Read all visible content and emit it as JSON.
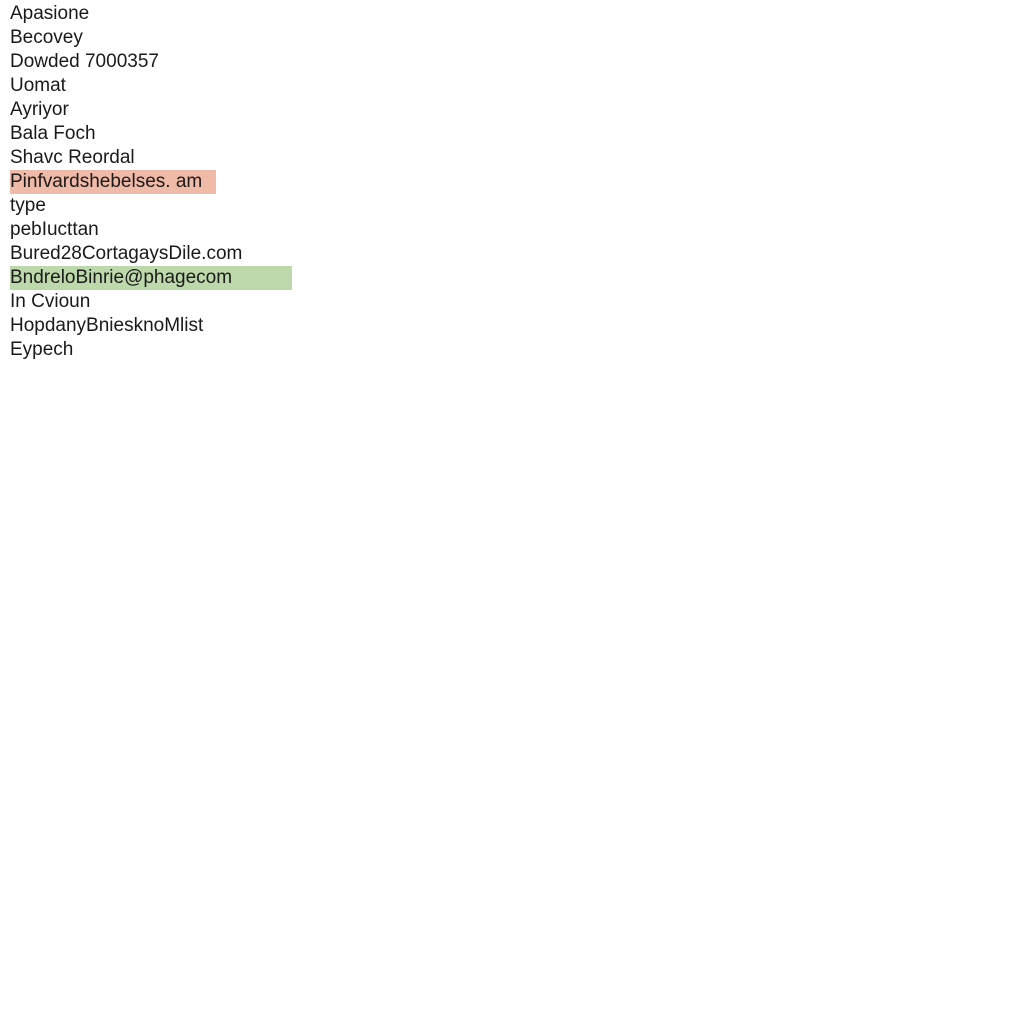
{
  "list": {
    "items": [
      {
        "text": "Apasione",
        "highlight": null
      },
      {
        "text": "Becovey",
        "highlight": null
      },
      {
        "text": "Dowded 7000357",
        "highlight": null
      },
      {
        "text": "Uomat",
        "highlight": null
      },
      {
        "text": "Ayriyor",
        "highlight": null
      },
      {
        "text": "Bala Foch",
        "highlight": null
      },
      {
        "text": "Shavc Reordal",
        "highlight": null
      },
      {
        "text": "Pinfvardshebelses. am",
        "highlight": "red"
      },
      {
        "text": "type",
        "highlight": null
      },
      {
        "text": "pebIucttan",
        "highlight": null
      },
      {
        "text": "Bured28CortagaysDile.com",
        "highlight": null
      },
      {
        "text": "BndreloBinrie@phagecom",
        "highlight": "green"
      },
      {
        "text": "In Cvioun",
        "highlight": null
      },
      {
        "text": "HopdanyBniesknoMlist",
        "highlight": null
      },
      {
        "text": "Eypech",
        "highlight": null
      }
    ]
  }
}
